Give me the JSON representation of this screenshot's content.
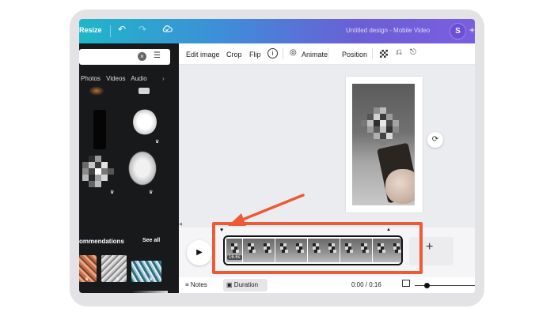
{
  "topbar": {
    "resize_label": "Resize",
    "undo_icon": "undo-icon",
    "redo_icon": "redo-icon",
    "cloud_icon": "cloud-check-icon",
    "document_title": "Untitled design - Mobile Video",
    "avatar_initial": "S",
    "plus_label": "+"
  },
  "left_panel": {
    "search_value": "",
    "tabs": [
      "Photos",
      "Videos",
      "Audio"
    ],
    "tabs_more_icon": "chevron-right-icon",
    "recommendations_label": "ommendations",
    "see_all_label": "See all"
  },
  "toolbar": {
    "edit_image": "Edit image",
    "crop": "Crop",
    "flip": "Flip",
    "info_icon": "info-icon",
    "animate": "Animate",
    "position": "Position",
    "transparency_icon": "transparency-icon",
    "paint_roller_icon": "paint-roller-icon",
    "lock_icon": "lock-icon"
  },
  "timeline": {
    "clip_duration": "16.6s",
    "frame_count": 11,
    "add_label": "+"
  },
  "bottom_bar": {
    "notes_label": "Notes",
    "duration_label": "Duration",
    "time_display": "0:00 / 0:16"
  },
  "annotation": {
    "highlight_color": "#ec5a36",
    "arrow_color": "#ec5a36"
  },
  "colors": {
    "topbar_gradient_start": "#1fb6c9",
    "topbar_gradient_end": "#7b5ee0",
    "left_panel_bg": "#18191b",
    "canvas_bg": "#ebecf0"
  }
}
